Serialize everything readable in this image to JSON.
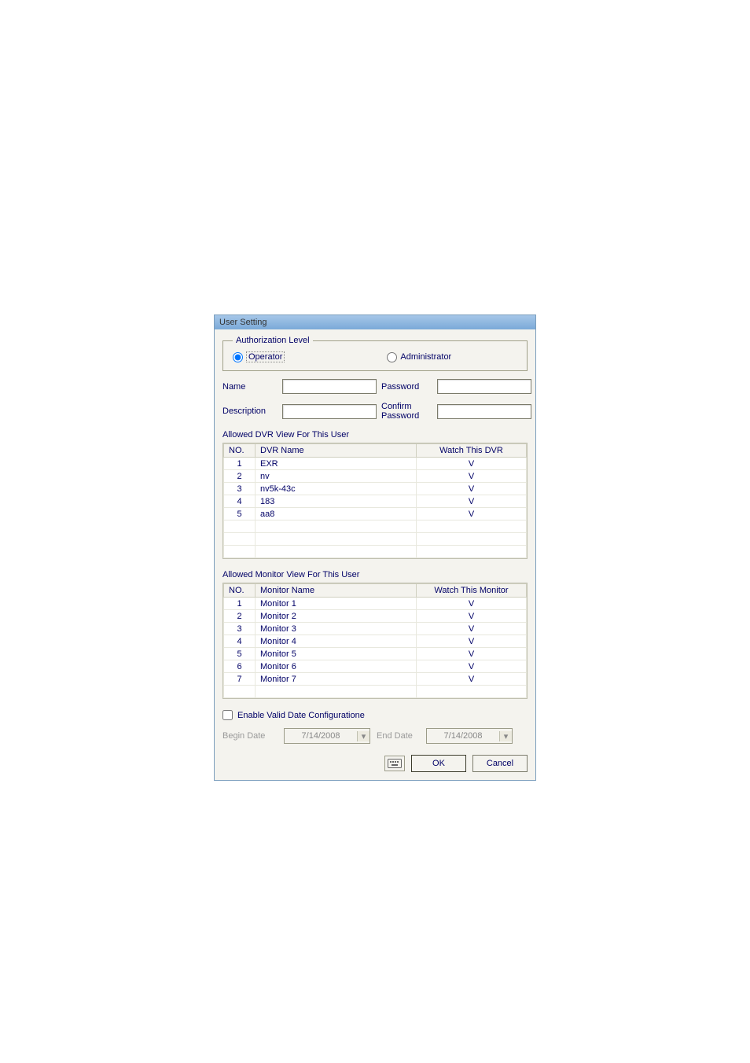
{
  "titlebar": "User Setting",
  "authLevel": {
    "legend": "Authorization Level",
    "operator": "Operator",
    "administrator": "Administrator",
    "selected": "operator"
  },
  "form": {
    "nameLabel": "Name",
    "nameValue": "",
    "passwordLabel": "Password",
    "passwordValue": "",
    "descriptionLabel": "Description",
    "descriptionValue": "",
    "confirmLabel": "Confirm Password",
    "confirmValue": ""
  },
  "dvrSection": {
    "heading": "Allowed DVR View For This User",
    "cols": {
      "no": "NO.",
      "name": "DVR Name",
      "watch": "Watch This DVR"
    },
    "rows": [
      {
        "no": "1",
        "name": "EXR",
        "watch": "V"
      },
      {
        "no": "2",
        "name": "nv",
        "watch": "V"
      },
      {
        "no": "3",
        "name": "nv5k-43c",
        "watch": "V"
      },
      {
        "no": "4",
        "name": "183",
        "watch": "V"
      },
      {
        "no": "5",
        "name": "aa8",
        "watch": "V"
      }
    ]
  },
  "monitorSection": {
    "heading": "Allowed Monitor View For This User",
    "cols": {
      "no": "NO.",
      "name": "Monitor Name",
      "watch": "Watch This Monitor"
    },
    "rows": [
      {
        "no": "1",
        "name": "Monitor 1",
        "watch": "V"
      },
      {
        "no": "2",
        "name": "Monitor 2",
        "watch": "V"
      },
      {
        "no": "3",
        "name": "Monitor 3",
        "watch": "V"
      },
      {
        "no": "4",
        "name": "Monitor 4",
        "watch": "V"
      },
      {
        "no": "5",
        "name": "Monitor 5",
        "watch": "V"
      },
      {
        "no": "6",
        "name": "Monitor 6",
        "watch": "V"
      },
      {
        "no": "7",
        "name": "Monitor 7",
        "watch": "V"
      }
    ]
  },
  "validDate": {
    "checkboxLabel": "Enable Valid Date Configuratione",
    "beginLabel": "Begin Date",
    "beginValue": "7/14/2008",
    "endLabel": "End Date",
    "endValue": "7/14/2008"
  },
  "buttons": {
    "ok": "OK",
    "cancel": "Cancel"
  }
}
